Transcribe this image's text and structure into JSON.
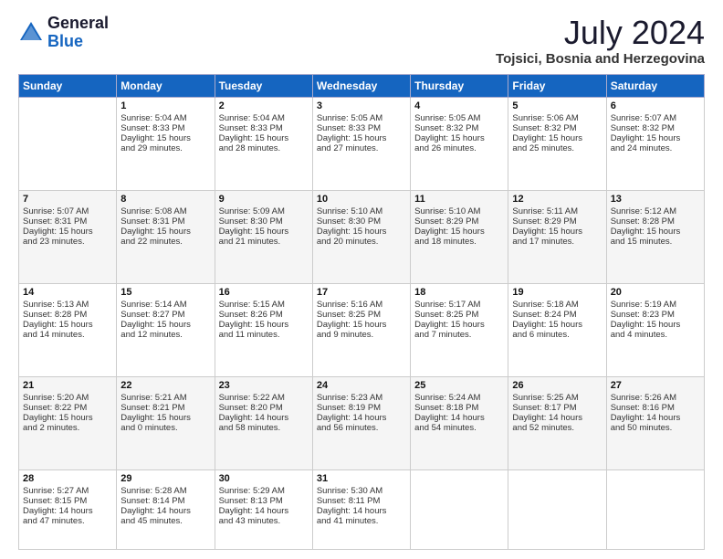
{
  "header": {
    "logo_general": "General",
    "logo_blue": "Blue",
    "month_year": "July 2024",
    "location": "Tojsici, Bosnia and Herzegovina"
  },
  "days_of_week": [
    "Sunday",
    "Monday",
    "Tuesday",
    "Wednesday",
    "Thursday",
    "Friday",
    "Saturday"
  ],
  "weeks": [
    [
      {
        "day": "",
        "info": ""
      },
      {
        "day": "1",
        "info": "Sunrise: 5:04 AM\nSunset: 8:33 PM\nDaylight: 15 hours\nand 29 minutes."
      },
      {
        "day": "2",
        "info": "Sunrise: 5:04 AM\nSunset: 8:33 PM\nDaylight: 15 hours\nand 28 minutes."
      },
      {
        "day": "3",
        "info": "Sunrise: 5:05 AM\nSunset: 8:33 PM\nDaylight: 15 hours\nand 27 minutes."
      },
      {
        "day": "4",
        "info": "Sunrise: 5:05 AM\nSunset: 8:32 PM\nDaylight: 15 hours\nand 26 minutes."
      },
      {
        "day": "5",
        "info": "Sunrise: 5:06 AM\nSunset: 8:32 PM\nDaylight: 15 hours\nand 25 minutes."
      },
      {
        "day": "6",
        "info": "Sunrise: 5:07 AM\nSunset: 8:32 PM\nDaylight: 15 hours\nand 24 minutes."
      }
    ],
    [
      {
        "day": "7",
        "info": "Sunrise: 5:07 AM\nSunset: 8:31 PM\nDaylight: 15 hours\nand 23 minutes."
      },
      {
        "day": "8",
        "info": "Sunrise: 5:08 AM\nSunset: 8:31 PM\nDaylight: 15 hours\nand 22 minutes."
      },
      {
        "day": "9",
        "info": "Sunrise: 5:09 AM\nSunset: 8:30 PM\nDaylight: 15 hours\nand 21 minutes."
      },
      {
        "day": "10",
        "info": "Sunrise: 5:10 AM\nSunset: 8:30 PM\nDaylight: 15 hours\nand 20 minutes."
      },
      {
        "day": "11",
        "info": "Sunrise: 5:10 AM\nSunset: 8:29 PM\nDaylight: 15 hours\nand 18 minutes."
      },
      {
        "day": "12",
        "info": "Sunrise: 5:11 AM\nSunset: 8:29 PM\nDaylight: 15 hours\nand 17 minutes."
      },
      {
        "day": "13",
        "info": "Sunrise: 5:12 AM\nSunset: 8:28 PM\nDaylight: 15 hours\nand 15 minutes."
      }
    ],
    [
      {
        "day": "14",
        "info": "Sunrise: 5:13 AM\nSunset: 8:28 PM\nDaylight: 15 hours\nand 14 minutes."
      },
      {
        "day": "15",
        "info": "Sunrise: 5:14 AM\nSunset: 8:27 PM\nDaylight: 15 hours\nand 12 minutes."
      },
      {
        "day": "16",
        "info": "Sunrise: 5:15 AM\nSunset: 8:26 PM\nDaylight: 15 hours\nand 11 minutes."
      },
      {
        "day": "17",
        "info": "Sunrise: 5:16 AM\nSunset: 8:25 PM\nDaylight: 15 hours\nand 9 minutes."
      },
      {
        "day": "18",
        "info": "Sunrise: 5:17 AM\nSunset: 8:25 PM\nDaylight: 15 hours\nand 7 minutes."
      },
      {
        "day": "19",
        "info": "Sunrise: 5:18 AM\nSunset: 8:24 PM\nDaylight: 15 hours\nand 6 minutes."
      },
      {
        "day": "20",
        "info": "Sunrise: 5:19 AM\nSunset: 8:23 PM\nDaylight: 15 hours\nand 4 minutes."
      }
    ],
    [
      {
        "day": "21",
        "info": "Sunrise: 5:20 AM\nSunset: 8:22 PM\nDaylight: 15 hours\nand 2 minutes."
      },
      {
        "day": "22",
        "info": "Sunrise: 5:21 AM\nSunset: 8:21 PM\nDaylight: 15 hours\nand 0 minutes."
      },
      {
        "day": "23",
        "info": "Sunrise: 5:22 AM\nSunset: 8:20 PM\nDaylight: 14 hours\nand 58 minutes."
      },
      {
        "day": "24",
        "info": "Sunrise: 5:23 AM\nSunset: 8:19 PM\nDaylight: 14 hours\nand 56 minutes."
      },
      {
        "day": "25",
        "info": "Sunrise: 5:24 AM\nSunset: 8:18 PM\nDaylight: 14 hours\nand 54 minutes."
      },
      {
        "day": "26",
        "info": "Sunrise: 5:25 AM\nSunset: 8:17 PM\nDaylight: 14 hours\nand 52 minutes."
      },
      {
        "day": "27",
        "info": "Sunrise: 5:26 AM\nSunset: 8:16 PM\nDaylight: 14 hours\nand 50 minutes."
      }
    ],
    [
      {
        "day": "28",
        "info": "Sunrise: 5:27 AM\nSunset: 8:15 PM\nDaylight: 14 hours\nand 47 minutes."
      },
      {
        "day": "29",
        "info": "Sunrise: 5:28 AM\nSunset: 8:14 PM\nDaylight: 14 hours\nand 45 minutes."
      },
      {
        "day": "30",
        "info": "Sunrise: 5:29 AM\nSunset: 8:13 PM\nDaylight: 14 hours\nand 43 minutes."
      },
      {
        "day": "31",
        "info": "Sunrise: 5:30 AM\nSunset: 8:11 PM\nDaylight: 14 hours\nand 41 minutes."
      },
      {
        "day": "",
        "info": ""
      },
      {
        "day": "",
        "info": ""
      },
      {
        "day": "",
        "info": ""
      }
    ]
  ]
}
